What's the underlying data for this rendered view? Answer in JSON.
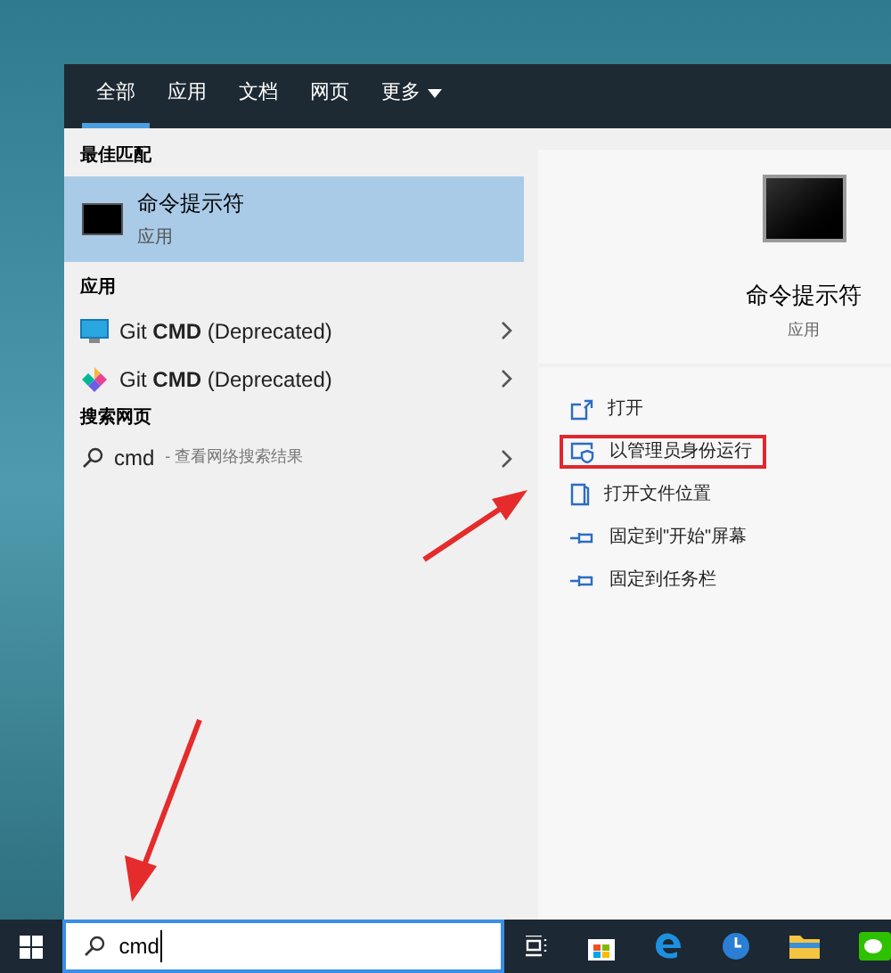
{
  "tabs": [
    {
      "label": "全部",
      "selected": true
    },
    {
      "label": "应用",
      "selected": false
    },
    {
      "label": "文档",
      "selected": false
    },
    {
      "label": "网页",
      "selected": false
    },
    {
      "label": "更多",
      "selected": false,
      "dropdown": true
    }
  ],
  "best_match": {
    "heading": "最佳匹配",
    "title": "命令提示符",
    "subtitle": "应用",
    "selected": true
  },
  "apps": {
    "heading": "应用",
    "items": [
      {
        "parts": "Git **CMD** (Deprecated)",
        "kind": "monitor"
      },
      {
        "parts": "Git **CMD** (Deprecated)",
        "kind": "diamond"
      }
    ]
  },
  "web": {
    "heading": "搜索网页",
    "query": "cmd",
    "hint": "- 查看网络搜索结果"
  },
  "detail": {
    "title": "命令提示符",
    "subtitle": "应用",
    "actions": [
      {
        "label": "打开",
        "kind": "open",
        "highlighted": false
      },
      {
        "label": "以管理员身份运行",
        "kind": "admin",
        "highlighted": true
      },
      {
        "label": "打开文件位置",
        "kind": "folder",
        "highlighted": false
      },
      {
        "label": "固定到\"开始\"屏幕",
        "kind": "pin",
        "highlighted": false
      },
      {
        "label": "固定到任务栏",
        "kind": "pin",
        "highlighted": false
      }
    ]
  },
  "taskbar": {
    "search_value": "cmd"
  }
}
